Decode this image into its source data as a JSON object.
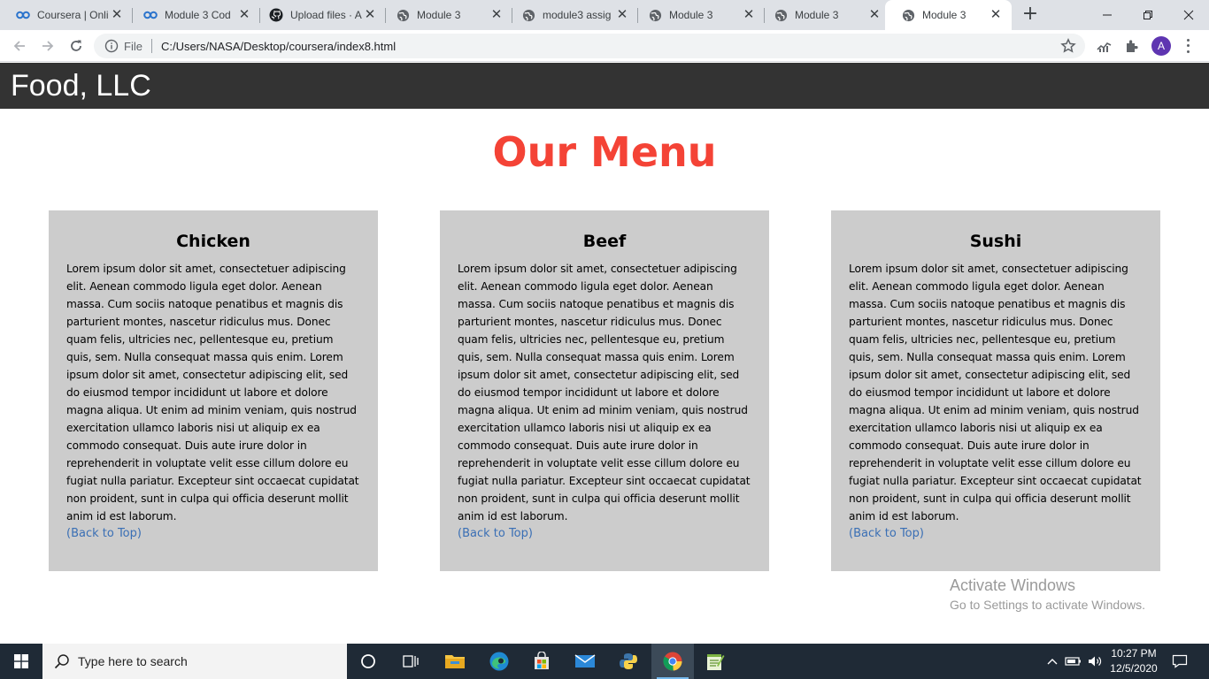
{
  "browser": {
    "tabs": [
      {
        "title": "Coursera | Onli",
        "icon": "coursera-icon"
      },
      {
        "title": "Module 3 Cod",
        "icon": "coursera-icon"
      },
      {
        "title": "Upload files · A",
        "icon": "github-icon"
      },
      {
        "title": "Module 3",
        "icon": "globe-icon"
      },
      {
        "title": "module3 assig",
        "icon": "globe-icon"
      },
      {
        "title": "Module 3",
        "icon": "globe-icon"
      },
      {
        "title": "Module 3",
        "icon": "globe-icon"
      },
      {
        "title": "Module 3",
        "icon": "globe-icon",
        "active": true
      }
    ],
    "address": {
      "scheme_label": "File",
      "url": "C:/Users/NASA/Desktop/coursera/index8.html"
    },
    "profile_initial": "A"
  },
  "site": {
    "brand": "Food, LLC",
    "menu_title": "Our Menu",
    "colors": {
      "header_bg": "#333333",
      "title": "#f44336",
      "card_bg": "#cccccc",
      "link": "#3a6fb5"
    },
    "cards": [
      {
        "title": "Chicken",
        "body": "Lorem ipsum dolor sit amet, consectetuer adipiscing elit. Aenean commodo ligula eget dolor. Aenean massa. Cum sociis natoque penatibus et magnis dis parturient montes, nascetur ridiculus mus. Donec quam felis, ultricies nec, pellentesque eu, pretium quis, sem. Nulla consequat massa quis enim. Lorem ipsum dolor sit amet, consectetur adipiscing elit, sed do eiusmod tempor incididunt ut labore et dolore magna aliqua. Ut enim ad minim veniam, quis nostrud exercitation ullamco laboris nisi ut aliquip ex ea commodo consequat. Duis aute irure dolor in reprehenderit in voluptate velit esse cillum dolore eu fugiat nulla pariatur. Excepteur sint occaecat cupidatat non proident, sunt in culpa qui officia deserunt mollit anim id est laborum.",
        "link": "(Back to Top)"
      },
      {
        "title": "Beef",
        "body": "Lorem ipsum dolor sit amet, consectetuer adipiscing elit. Aenean commodo ligula eget dolor. Aenean massa. Cum sociis natoque penatibus et magnis dis parturient montes, nascetur ridiculus mus. Donec quam felis, ultricies nec, pellentesque eu, pretium quis, sem. Nulla consequat massa quis enim. Lorem ipsum dolor sit amet, consectetur adipiscing elit, sed do eiusmod tempor incididunt ut labore et dolore magna aliqua. Ut enim ad minim veniam, quis nostrud exercitation ullamco laboris nisi ut aliquip ex ea commodo consequat. Duis aute irure dolor in reprehenderit in voluptate velit esse cillum dolore eu fugiat nulla pariatur. Excepteur sint occaecat cupidatat non proident, sunt in culpa qui officia deserunt mollit anim id est laborum.",
        "link": "(Back to Top)"
      },
      {
        "title": "Sushi",
        "body": "Lorem ipsum dolor sit amet, consectetuer adipiscing elit. Aenean commodo ligula eget dolor. Aenean massa. Cum sociis natoque penatibus et magnis dis parturient montes, nascetur ridiculus mus. Donec quam felis, ultricies nec, pellentesque eu, pretium quis, sem. Nulla consequat massa quis enim. Lorem ipsum dolor sit amet, consectetur adipiscing elit, sed do eiusmod tempor incididunt ut labore et dolore magna aliqua. Ut enim ad minim veniam, quis nostrud exercitation ullamco laboris nisi ut aliquip ex ea commodo consequat. Duis aute irure dolor in reprehenderit in voluptate velit esse cillum dolore eu fugiat nulla pariatur. Excepteur sint occaecat cupidatat non proident, sunt in culpa qui officia deserunt mollit anim id est laborum.",
        "link": "(Back to Top)"
      }
    ]
  },
  "watermark": {
    "line1": "Activate Windows",
    "line2": "Go to Settings to activate Windows."
  },
  "taskbar": {
    "search_placeholder": "Type here to search",
    "apps": [
      "cortana-icon",
      "task-view-icon",
      "file-explorer-icon",
      "edge-icon",
      "store-icon",
      "mail-icon",
      "python-icon",
      "chrome-icon",
      "notepad-plus-icon"
    ],
    "time": "10:27 PM",
    "date": "12/5/2020"
  }
}
